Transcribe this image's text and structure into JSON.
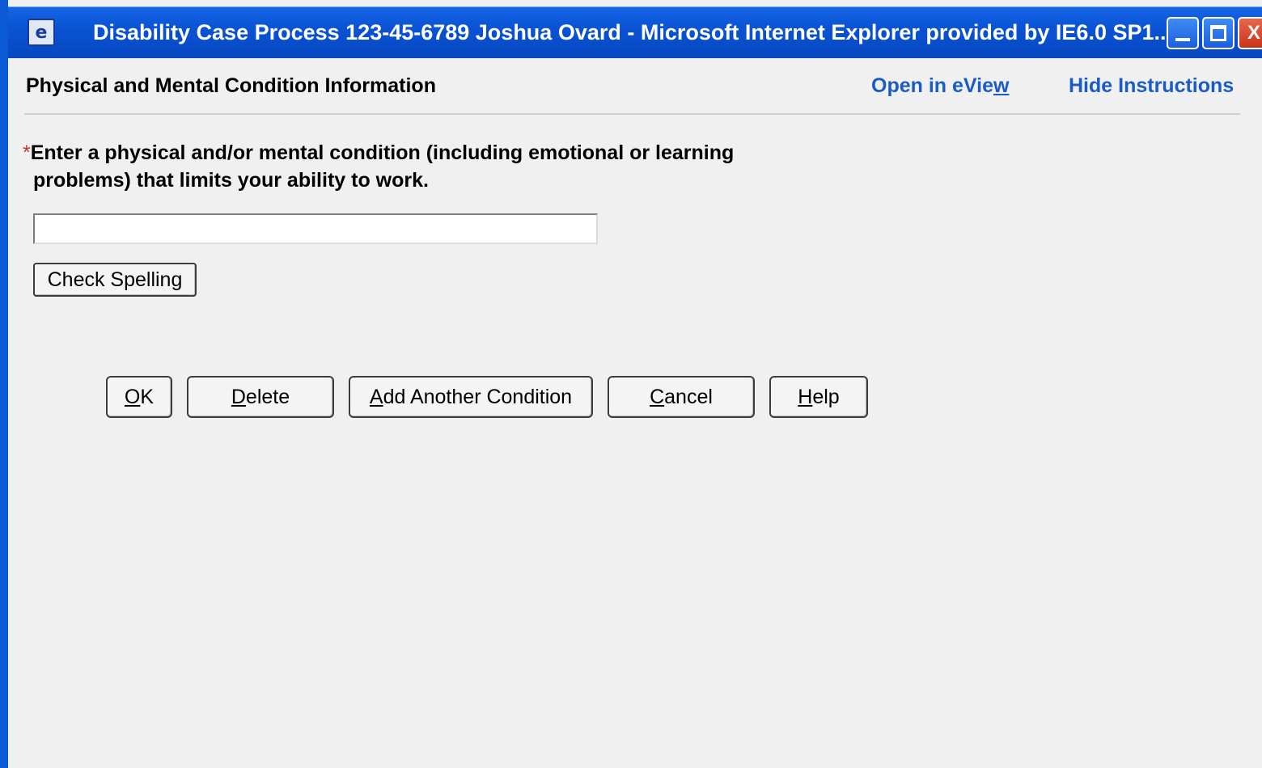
{
  "window": {
    "title": "Disability Case Process 123-45-6789 Joshua Ovard  -  Microsoft Internet Explorer provided by IE6.0 SP1...",
    "icon": "ie-page-icon",
    "close_label": "X"
  },
  "header": {
    "title": "Physical and Mental Condition Information",
    "open_eview": {
      "before": "Open in eVie",
      "accel": "w",
      "after": ""
    },
    "hide_instructions": "Hide Instructions"
  },
  "form": {
    "required_marker": "*",
    "question_line1": "Enter a physical and/or mental condition (including emotional or learning",
    "question_line2": "problems) that limits your ability to work.",
    "condition_value": "",
    "check_spelling_label": "Check Spelling"
  },
  "actions": {
    "ok": {
      "accel": "O",
      "rest": "K"
    },
    "delete": {
      "accel": "D",
      "rest": "elete"
    },
    "add": {
      "accel": "A",
      "rest": "dd Another Condition"
    },
    "cancel": {
      "accel": "C",
      "rest": "ancel"
    },
    "help": {
      "accel": "H",
      "rest": "elp"
    }
  },
  "colors": {
    "titlebar": "#0a53d4",
    "link": "#1a5bc4",
    "background": "#f0f0f0",
    "required": "#c0392b"
  }
}
